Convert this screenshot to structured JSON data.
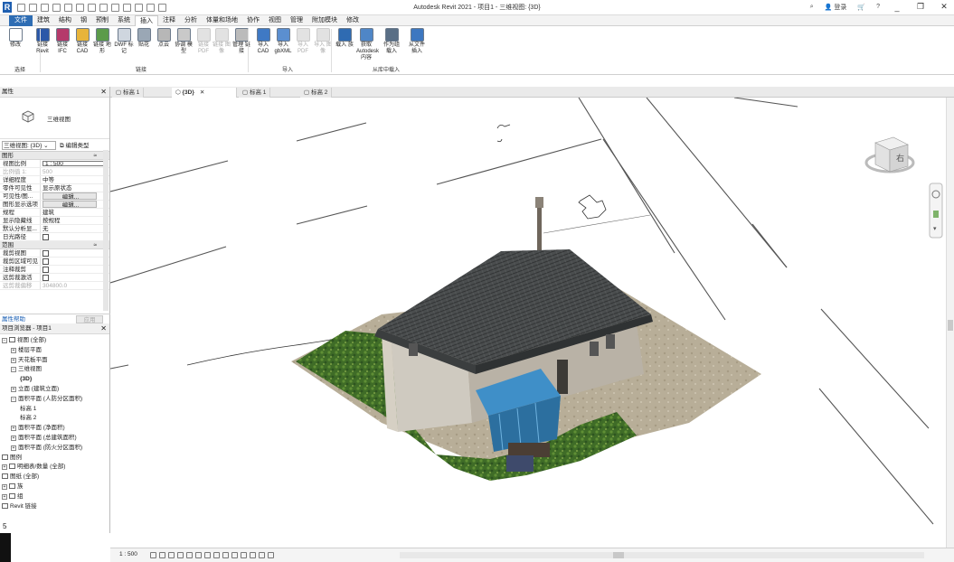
{
  "app": {
    "window_title": "Autodesk Revit 2021 - 项目1 - 三维视图: {3D}",
    "sign_in": "登录",
    "help": "?"
  },
  "menu_tabs": [
    "文件",
    "建筑",
    "结构",
    "钢",
    "预制",
    "系统",
    "插入",
    "注释",
    "分析",
    "体量和场地",
    "协作",
    "视图",
    "管理",
    "附加模块",
    "修改"
  ],
  "active_menu_tab": "插入",
  "ribbon": {
    "buttons": [
      {
        "label": "修改",
        "icon": "modify-arrow-icon",
        "dim": false
      },
      {
        "label": "链接 Revit",
        "icon": "link-revit-icon",
        "dim": false
      },
      {
        "label": "链接 IFC",
        "icon": "link-ifc-icon",
        "dim": false
      },
      {
        "label": "链接 CAD",
        "icon": "link-cad-icon",
        "dim": false
      },
      {
        "label": "链接 地形",
        "icon": "link-topography-icon",
        "dim": false
      },
      {
        "label": "DWF 标记",
        "icon": "dwf-markup-icon",
        "dim": false
      },
      {
        "label": "贴花",
        "icon": "decal-icon",
        "dim": false
      },
      {
        "label": "点云",
        "icon": "point-cloud-icon",
        "dim": false
      },
      {
        "label": "协调 模型",
        "icon": "coordination-model-icon",
        "dim": false
      },
      {
        "label": "链接 PDF",
        "icon": "link-pdf-icon",
        "dim": true
      },
      {
        "label": "链接 图像",
        "icon": "link-image-icon",
        "dim": true
      },
      {
        "label": "管理 链接",
        "icon": "manage-links-icon",
        "dim": false
      },
      {
        "label": "导入 CAD",
        "icon": "import-cad-icon",
        "dim": false
      },
      {
        "label": "导入 gbXML",
        "icon": "import-gbxml-icon",
        "dim": false
      },
      {
        "label": "导入 PDF",
        "icon": "import-pdf-icon",
        "dim": true
      },
      {
        "label": "导入 图像",
        "icon": "import-image-icon",
        "dim": true
      },
      {
        "label": "载入 族",
        "icon": "load-family-icon",
        "dim": false
      },
      {
        "label": "获取 Autodesk 内容",
        "icon": "autodesk-content-icon",
        "dim": false
      },
      {
        "label": "作为组 载入",
        "icon": "load-as-group-icon",
        "dim": false
      },
      {
        "label": "从文件 插入",
        "icon": "insert-from-file-icon",
        "dim": false
      }
    ],
    "groups": [
      "选择",
      "链接",
      "导入",
      "从库中载入"
    ]
  },
  "doc_tabs": [
    {
      "label": "标高 1",
      "active": false,
      "close": false
    },
    {
      "label": "{3D}",
      "active": true,
      "close": true
    },
    {
      "label": "标高 1",
      "active": false,
      "close": false
    },
    {
      "label": "标高 2",
      "active": false,
      "close": false
    }
  ],
  "properties": {
    "header": "属性",
    "type_name": "三维视图",
    "type_selector": "三维视图: {3D}",
    "edit_type": "编辑类型",
    "section_graphics": "图形",
    "rows_graphics": [
      {
        "key": "视图比例",
        "value": "1 : 500",
        "kind": "box"
      },
      {
        "key": "比例值 1:",
        "value": "500",
        "kind": "grey"
      },
      {
        "key": "详细程度",
        "value": "中等",
        "kind": "text"
      },
      {
        "key": "零件可见性",
        "value": "显示原状态",
        "kind": "text"
      },
      {
        "key": "可见性/图...",
        "value": "编辑...",
        "kind": "btn"
      },
      {
        "key": "图形显示选项",
        "value": "编辑...",
        "kind": "btn"
      },
      {
        "key": "规程",
        "value": "建筑",
        "kind": "text"
      },
      {
        "key": "显示隐藏线",
        "value": "按规程",
        "kind": "text"
      },
      {
        "key": "默认分析显...",
        "value": "无",
        "kind": "text"
      },
      {
        "key": "日光路径",
        "value": "",
        "kind": "check"
      }
    ],
    "section_extents": "范围",
    "rows_extents": [
      {
        "key": "裁剪视图",
        "value": "",
        "kind": "check"
      },
      {
        "key": "裁剪区域可见",
        "value": "",
        "kind": "check"
      },
      {
        "key": "注释裁剪",
        "value": "",
        "kind": "check"
      },
      {
        "key": "远剪裁激活",
        "value": "",
        "kind": "check"
      },
      {
        "key": "远剪裁偏移",
        "value": "304800.0",
        "kind": "grey"
      }
    ],
    "help_link": "属性帮助",
    "apply": "应用"
  },
  "browser": {
    "header": "项目浏览器 - 项目1",
    "nodes": [
      {
        "label": "视图 (全部)",
        "indent": 0,
        "toggle": "⊟",
        "icon": true
      },
      {
        "label": "楼层平面",
        "indent": 1,
        "toggle": "⊞",
        "icon": false
      },
      {
        "label": "天花板平面",
        "indent": 1,
        "toggle": "⊞",
        "icon": false
      },
      {
        "label": "三维视图",
        "indent": 1,
        "toggle": "⊟",
        "icon": false
      },
      {
        "label": "{3D}",
        "indent": 2,
        "toggle": "",
        "icon": false,
        "bold": true
      },
      {
        "label": "立面 (建筑立面)",
        "indent": 1,
        "toggle": "⊞",
        "icon": false
      },
      {
        "label": "面积平面 (人防分区面积)",
        "indent": 1,
        "toggle": "⊟",
        "icon": false
      },
      {
        "label": "标高 1",
        "indent": 2,
        "toggle": "",
        "icon": false
      },
      {
        "label": "标高 2",
        "indent": 2,
        "toggle": "",
        "icon": false
      },
      {
        "label": "面积平面 (净面积)",
        "indent": 1,
        "toggle": "⊞",
        "icon": false
      },
      {
        "label": "面积平面 (总建筑面积)",
        "indent": 1,
        "toggle": "⊞",
        "icon": false
      },
      {
        "label": "面积平面 (防火分区面积)",
        "indent": 1,
        "toggle": "⊞",
        "icon": false
      },
      {
        "label": "图例",
        "indent": 0,
        "toggle": "",
        "icon": true
      },
      {
        "label": "明细表/数量 (全部)",
        "indent": 0,
        "toggle": "⊞",
        "icon": true
      },
      {
        "label": "图纸 (全部)",
        "indent": 0,
        "toggle": "",
        "icon": true
      },
      {
        "label": "族",
        "indent": 0,
        "toggle": "⊞",
        "icon": true
      },
      {
        "label": "组",
        "indent": 0,
        "toggle": "⊞",
        "icon": true
      },
      {
        "label": "Revit 链接",
        "indent": 0,
        "toggle": "",
        "icon": true
      }
    ]
  },
  "viewcube": {
    "face_label": "右"
  },
  "view_control": {
    "scale": "1 : 500"
  },
  "left_marker": "5",
  "colors": {
    "file_tab": "#2e6db4",
    "roof": "#4a4d4e",
    "awning": "#3f8fc8",
    "vegetation": "#4d7a2f",
    "ground": "#b9ad96"
  }
}
